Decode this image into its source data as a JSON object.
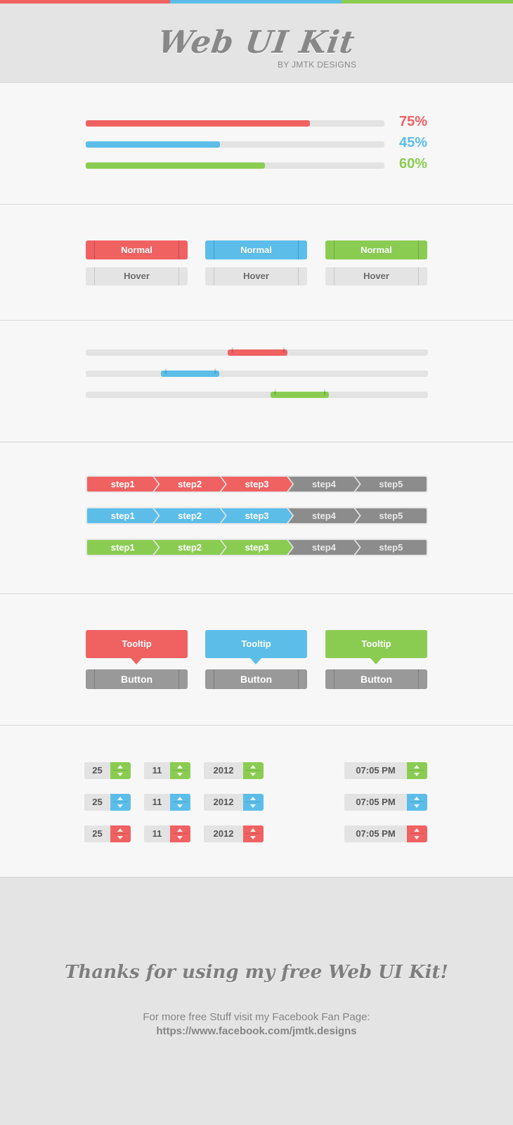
{
  "colors": {
    "red": "#f06162",
    "blue": "#5cbde9",
    "green": "#8acc52",
    "gray": "#8c8c8c"
  },
  "header": {
    "title": "Web UI Kit",
    "subtitle": "BY JMTK DESIGNS"
  },
  "progress": [
    {
      "color": "red",
      "value": 75,
      "label": "75%"
    },
    {
      "color": "blue",
      "value": 45,
      "label": "45%"
    },
    {
      "color": "green",
      "value": 60,
      "label": "60%"
    }
  ],
  "buttons": [
    {
      "color": "red",
      "normal": "Normal",
      "hover": "Hover"
    },
    {
      "color": "blue",
      "normal": "Normal",
      "hover": "Hover"
    },
    {
      "color": "green",
      "normal": "Normal",
      "hover": "Hover"
    }
  ],
  "sliders": [
    {
      "color": "red",
      "start": 0.415,
      "end": 0.59
    },
    {
      "color": "blue",
      "start": 0.22,
      "end": 0.39
    },
    {
      "color": "green",
      "start": 0.54,
      "end": 0.71
    }
  ],
  "steps": [
    {
      "color": "red",
      "labels": [
        "step1",
        "step2",
        "step3",
        "step4",
        "step5"
      ],
      "active_count": 3
    },
    {
      "color": "blue",
      "labels": [
        "step1",
        "step2",
        "step3",
        "step4",
        "step5"
      ],
      "active_count": 3
    },
    {
      "color": "green",
      "labels": [
        "step1",
        "step2",
        "step3",
        "step4",
        "step5"
      ],
      "active_count": 3
    }
  ],
  "tooltips": [
    {
      "color": "red",
      "tooltip": "Tooltip",
      "button": "Button"
    },
    {
      "color": "blue",
      "tooltip": "Tooltip",
      "button": "Button"
    },
    {
      "color": "green",
      "tooltip": "Tooltip",
      "button": "Button"
    }
  ],
  "steppers": [
    {
      "color": "green",
      "day": "25",
      "month": "11",
      "year": "2012",
      "time": "07:05 PM"
    },
    {
      "color": "blue",
      "day": "25",
      "month": "11",
      "year": "2012",
      "time": "07:05 PM"
    },
    {
      "color": "red",
      "day": "25",
      "month": "11",
      "year": "2012",
      "time": "07:05 PM"
    }
  ],
  "footer": {
    "thanks": "Thanks for using my free Web UI Kit!",
    "more": "For more free Stuff visit my Facebook Fan Page:",
    "link": "https://www.facebook.com/jmtk.designs"
  }
}
